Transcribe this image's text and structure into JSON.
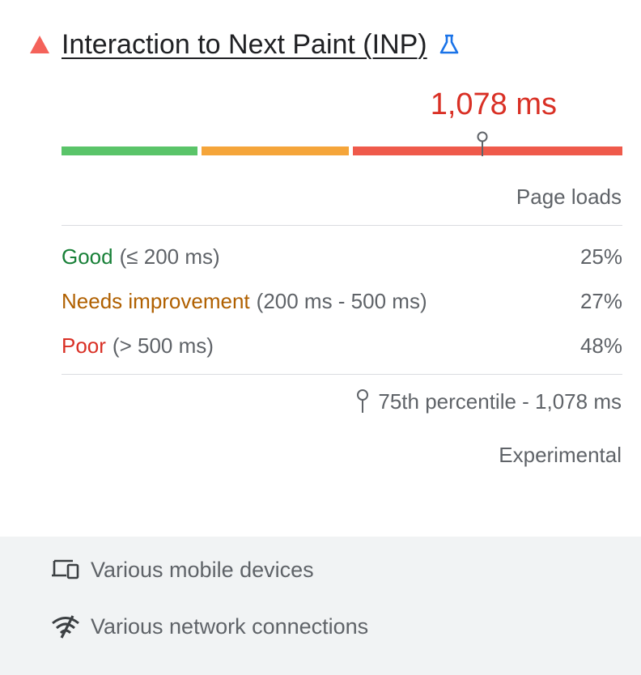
{
  "metric": {
    "title": "Interaction to Next Paint (INP)",
    "status_icon": "poor-triangle-icon",
    "lab_icon": "beaker-icon",
    "value": "1,078 ms",
    "p75_fraction": 0.75
  },
  "distribution": {
    "header": "Page loads",
    "rows": [
      {
        "name": "Good",
        "range": "(≤ 200 ms)",
        "percent": "25%",
        "fraction": 0.25,
        "color": "#5ac469"
      },
      {
        "name": "Needs improvement",
        "range": "(200 ms - 500 ms)",
        "percent": "27%",
        "fraction": 0.27,
        "color": "#f5a53a"
      },
      {
        "name": "Poor",
        "range": "(> 500 ms)",
        "percent": "48%",
        "fraction": 0.48,
        "color": "#ef5a4b"
      }
    ],
    "percentile_label": "75th percentile - 1,078 ms",
    "experimental_label": "Experimental"
  },
  "footer": {
    "devices": {
      "icon": "devices-icon",
      "label": "Various mobile devices"
    },
    "network": {
      "icon": "network-icon",
      "label": "Various network connections"
    }
  },
  "colors": {
    "poor_text": "#d93025",
    "good_text": "#188038",
    "ni_text": "#b06000",
    "lab_blue": "#1a73e8"
  }
}
